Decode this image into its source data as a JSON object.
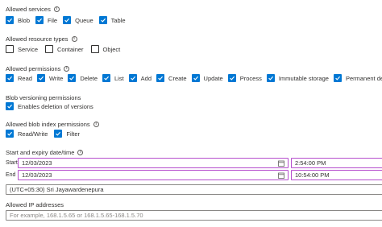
{
  "allowed_services": {
    "label": "Allowed services",
    "items": [
      {
        "label": "Blob",
        "checked": true
      },
      {
        "label": "File",
        "checked": true
      },
      {
        "label": "Queue",
        "checked": true
      },
      {
        "label": "Table",
        "checked": true
      }
    ]
  },
  "allowed_resource_types": {
    "label": "Allowed resource types",
    "items": [
      {
        "label": "Service",
        "checked": false
      },
      {
        "label": "Container",
        "checked": false
      },
      {
        "label": "Object",
        "checked": false
      }
    ]
  },
  "allowed_permissions": {
    "label": "Allowed permissions",
    "items": [
      {
        "label": "Read",
        "checked": true
      },
      {
        "label": "Write",
        "checked": true
      },
      {
        "label": "Delete",
        "checked": true
      },
      {
        "label": "List",
        "checked": true
      },
      {
        "label": "Add",
        "checked": true
      },
      {
        "label": "Create",
        "checked": true
      },
      {
        "label": "Update",
        "checked": true
      },
      {
        "label": "Process",
        "checked": true
      },
      {
        "label": "Immutable storage",
        "checked": true
      },
      {
        "label": "Permanent delete",
        "checked": true
      }
    ]
  },
  "blob_versioning": {
    "label": "Blob versioning permissions",
    "items": [
      {
        "label": "Enables deletion of versions",
        "checked": true
      }
    ]
  },
  "blob_index": {
    "label": "Allowed blob index permissions",
    "items": [
      {
        "label": "Read/Write",
        "checked": true
      },
      {
        "label": "Filter",
        "checked": true
      }
    ]
  },
  "expiry": {
    "label": "Start and expiry date/time",
    "start_label": "Start",
    "start_date": "12/03/2023",
    "start_time": "2:54:00 PM",
    "end_label": "End",
    "end_date": "12/03/2023",
    "end_time": "10:54:00 PM",
    "timezone": "(UTC+05:30) Sri Jayawardenepura"
  },
  "allowed_ip": {
    "label": "Allowed IP addresses",
    "placeholder": "For example, 168.1.5.65 or 168.1.5.65-168.1.5.70"
  },
  "colors": {
    "accent": "#0078d4",
    "focus_border": "#b54dcd"
  }
}
